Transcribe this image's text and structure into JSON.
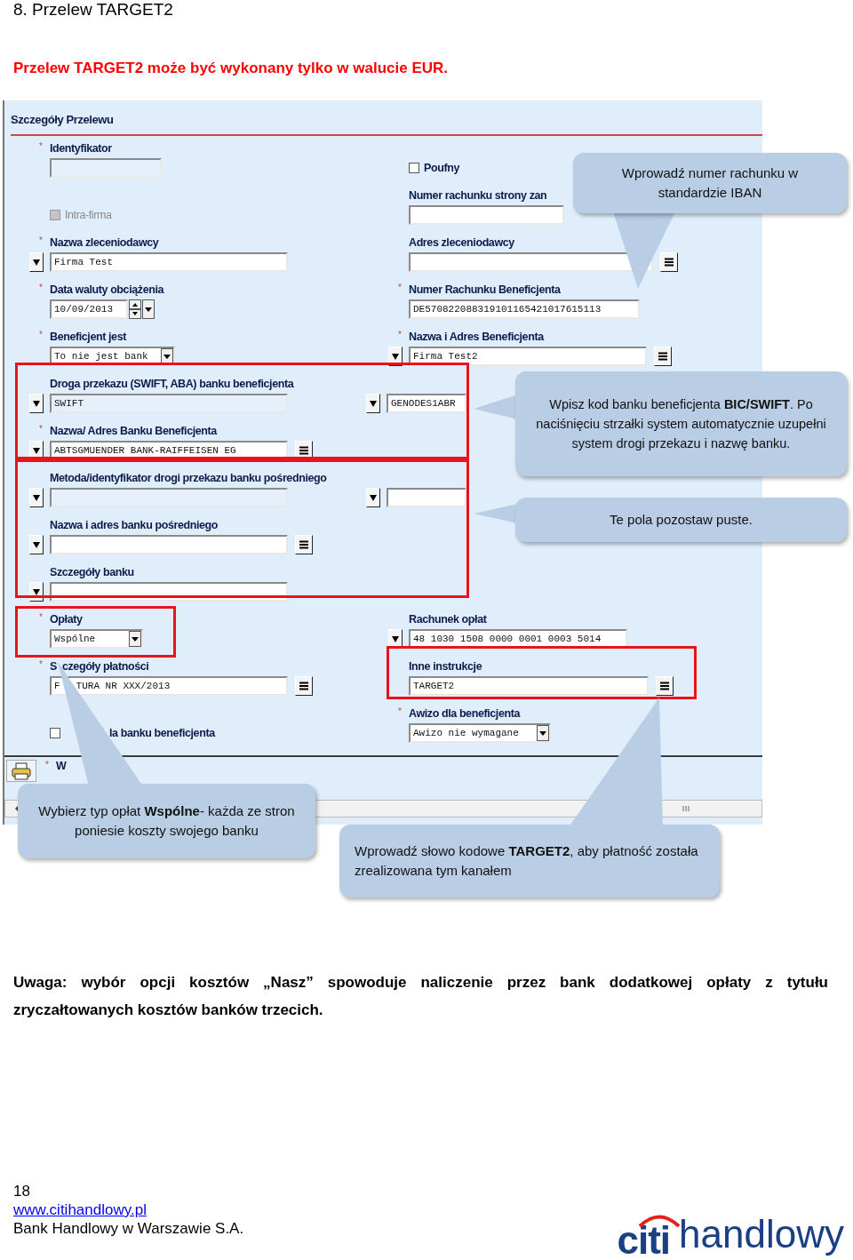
{
  "heading": "8. Przelew TARGET2",
  "notice": "Przelew TARGET2 może być wykonany tylko w walucie EUR.",
  "form": {
    "title": "Szczegóły Przelewu",
    "rows": [
      {
        "left": {
          "kind": "input",
          "marker": "*",
          "label": "Identyfikator",
          "disabled": true
        },
        "right": {
          "kind": "checkbox",
          "label": "Poufny",
          "checked": false,
          "disabled": false
        }
      },
      {
        "left": {
          "kind": "checkbox",
          "label": "Intra-firma",
          "checked": false,
          "disabled": true
        },
        "right": {
          "kind": "input",
          "label": "Numer rachunku strony zan",
          "disabled": false
        }
      },
      {
        "left": {
          "kind": "input",
          "marker": "*",
          "label": "Nazwa zleceniodawcy",
          "value": "Firma Test",
          "disabled": false,
          "buttons": [
            {
              "kind": "dropdown"
            }
          ]
        },
        "right": {
          "kind": "input",
          "label": "Adres zleceniodawcy",
          "disabled": false,
          "buttons": [
            {
              "kind": "menu"
            }
          ]
        }
      },
      {
        "left": {
          "kind": "date",
          "marker": "*",
          "label": "Data waluty obciążenia",
          "value": "10/09/2013",
          "disabled": false
        },
        "right": {
          "kind": "input",
          "marker": "*",
          "label": "Numer Rachunku Beneficjenta",
          "value": "DE570822088319101165421017615113",
          "disabled": false
        }
      },
      {
        "left": {
          "kind": "select",
          "marker": "*",
          "label": "Beneficjent jest",
          "value": "To nie jest bank",
          "disabled": false
        },
        "right": {
          "kind": "input",
          "marker": "*",
          "label": "Nazwa i Adres Beneficjenta",
          "value": "Firma Test2",
          "disabled": false,
          "buttons": [
            {
              "kind": "dropdown"
            },
            {
              "kind": "menu"
            }
          ]
        }
      },
      {
        "left": {
          "kind": "input",
          "label": "Droga przekazu (SWIFT, ABA) banku beneficjenta",
          "value": "SWIFT",
          "disabled": true,
          "buttons": [
            {
              "kind": "dropdown"
            }
          ]
        },
        "right": {
          "kind": "input",
          "value": "GENODES1ABR",
          "disabled": false,
          "buttons": [
            {
              "kind": "dropdown"
            }
          ]
        }
      },
      {
        "left": {
          "kind": "input",
          "marker": "*",
          "label": "Nazwa/ Adres Banku Beneficjenta",
          "value": "ABTSGMUENDER BANK-RAIFFEISEN EG",
          "disabled": false,
          "buttons": [
            {
              "kind": "dropdown"
            },
            {
              "kind": "menu"
            }
          ]
        }
      },
      {
        "left": {
          "kind": "input",
          "label": "Metoda/identyfikator drogi przekazu banku pośredniego",
          "disabled": true,
          "buttons": [
            {
              "kind": "dropdown"
            }
          ]
        },
        "right": {
          "kind": "input",
          "disabled": false,
          "buttons": [
            {
              "kind": "dropdown"
            }
          ]
        }
      },
      {
        "left": {
          "kind": "input",
          "label": "Nazwa i adres banku pośredniego",
          "disabled": false,
          "buttons": [
            {
              "kind": "dropdown"
            },
            {
              "kind": "menu"
            }
          ]
        }
      },
      {
        "left": {
          "kind": "input",
          "label": "Szczegóły banku",
          "disabled": false,
          "buttons": [
            {
              "kind": "dropdown"
            }
          ]
        }
      },
      {
        "left": {
          "kind": "select",
          "marker": "*",
          "label": "Opłaty",
          "value": "Wspólne",
          "disabled": false
        },
        "right": {
          "kind": "input",
          "label": "Rachunek opłat",
          "value": "48 1030 1508 0000 0001 0003 5014",
          "disabled": false,
          "buttons": [
            {
              "kind": "dropdown"
            }
          ]
        }
      },
      {
        "left": {
          "kind": "input",
          "marker": "*",
          "label": [
            "S",
            "czegóły płatności"
          ],
          "value": [
            "F",
            "TURA NR XXX/2013"
          ],
          "disabled": false,
          "buttons": [
            {
              "kind": "menu"
            }
          ]
        },
        "right": {
          "kind": "input",
          "label": "Inne instrukcje",
          "value": "TARGET2",
          "disabled": false,
          "buttons": [
            {
              "kind": "menu"
            }
          ]
        }
      },
      {
        "left": {
          "kind": "checkbox",
          "label": "la banku beneficjenta",
          "checked": false,
          "disabled": false
        },
        "right": {
          "kind": "select",
          "marker": "*",
          "label": "Awizo dla beneficjenta",
          "value": "Awizo nie wymagane",
          "disabled": false
        }
      }
    ],
    "bottom_bar": {
      "marker": "*",
      "text": "W"
    }
  },
  "callouts": [
    {
      "text": "Wprowadź numer rachunku w standardzie IBAN"
    },
    {
      "text": "Wpisz kod banku beneficjenta **BIC/SWIFT**. Po naciśnięciu strzałki system automatycznie uzupełni system drogi przekazu i nazwę banku."
    },
    {
      "text": "Te pola pozostaw puste."
    },
    {
      "text": "Wybierz typ opłat **Wspólne**- każda ze stron poniesie koszty swojego banku"
    },
    {
      "text": "Wprowadź słowo  kodowe **TARGET2**, aby płatność została zrealizowana tym kanałem"
    }
  ],
  "remark": "Uwaga: wybór opcji kosztów „Nasz” spowoduje naliczenie przez bank dodatkowej opłaty z tytułu zryczałtowanych kosztów banków trzecich.",
  "footer": {
    "page_number": "18",
    "link": "www.citihandlowy.pl",
    "company": "Bank Handlowy w Warszawie S.A."
  },
  "logo": {
    "brand": "citi",
    "name": "handlowy"
  }
}
